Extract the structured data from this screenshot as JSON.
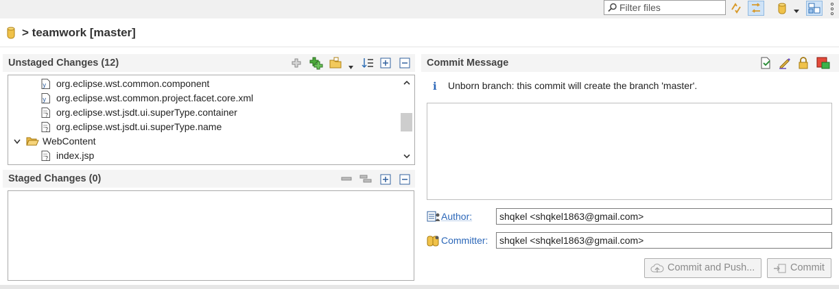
{
  "toolbar": {
    "filter_placeholder": "Filter files"
  },
  "header": {
    "title": "teamwork [master]",
    "separator": ">"
  },
  "unstaged": {
    "title": "Unstaged Changes (12)",
    "rows": [
      {
        "label": "org.eclipse.wst.common.component"
      },
      {
        "label": "org.eclipse.wst.common.project.facet.core.xml"
      },
      {
        "label": "org.eclipse.wst.jsdt.ui.superType.container"
      },
      {
        "label": "org.eclipse.wst.jsdt.ui.superType.name"
      },
      {
        "label": "WebContent"
      },
      {
        "label": "index.jsp"
      }
    ]
  },
  "staged": {
    "title": "Staged Changes (0)"
  },
  "commit": {
    "title": "Commit Message",
    "info": "Unborn branch: this commit will create the branch 'master'.",
    "author_label": "Author:",
    "author_value": "shqkel <shqkel1863@gmail.com>",
    "committer_label": "Committer:",
    "committer_value": "shqkel <shqkel1863@gmail.com>",
    "commit_push_label": "Commit and Push...",
    "commit_label": "Commit"
  },
  "colors": {
    "link": "#2a66b8",
    "info": "#2a66b8",
    "folder": "#e8b84a"
  }
}
